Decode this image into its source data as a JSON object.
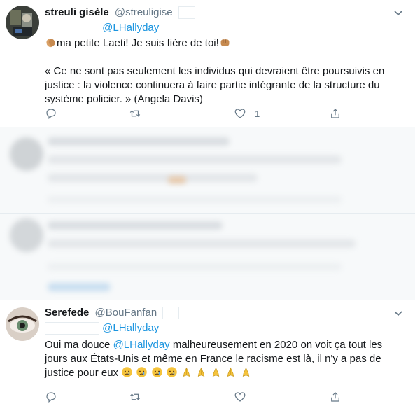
{
  "tweet1": {
    "name": "streuli gisèle",
    "handle": "@streuligise",
    "reply_to": "@LHallyday",
    "line1_text": "ma petite Laeti! Je suis fière de toi!",
    "quote_line1": "« Ce ne sont pas seulement les individus qui devraient être poursuivis en",
    "quote_line2": "justice : la violence continuera à faire partie intégrante de la structure du",
    "quote_line3": "système policier. » (Angela Davis)",
    "like_count": "1"
  },
  "tweet2": {
    "name": "Serefede",
    "handle": "@BouFanfan",
    "reply_to": "@LHallyday",
    "line1_pre": "Oui ma douce ",
    "line1_mention": "@LHallyday",
    "line1_post": " malheureusement en 2020 on voit ça tout les",
    "line2": "jours aux États-Unis et même en France le racisme est là, il n'y a pas de",
    "line3": "justice pour eux"
  },
  "icons": {
    "reply": "reply-icon",
    "retweet": "retweet-icon",
    "like": "heart-icon",
    "share": "share-icon",
    "more": "chevron-down-icon"
  },
  "colors": {
    "link": "#1b95e0",
    "muted": "#657786",
    "text": "#14171a",
    "divider": "#e6ecf0"
  }
}
